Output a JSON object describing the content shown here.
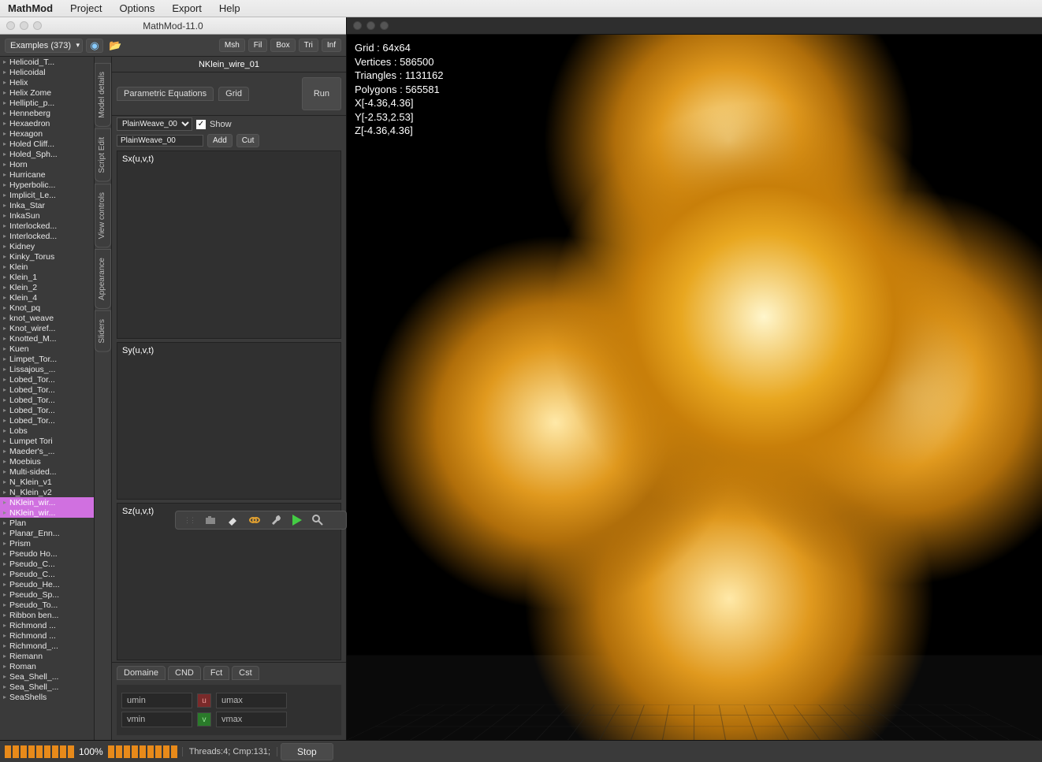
{
  "menu": {
    "app": "MathMod",
    "items": [
      "Project",
      "Options",
      "Export",
      "Help"
    ]
  },
  "leftWin": {
    "title": "MathMod-11.0"
  },
  "toolbar": {
    "dropdown": "Examples (373)",
    "buttons": [
      "Msh",
      "Fil",
      "Box",
      "Tri",
      "Inf"
    ]
  },
  "examples": [
    "Helicoid_T...",
    "Helicoidal",
    "Helix",
    "Helix Zome",
    "Helliptic_p...",
    "Henneberg",
    "Hexaedron",
    "Hexagon",
    "Holed Cliff...",
    "Holed_Sph...",
    "Horn",
    "Hurricane",
    "Hyperbolic...",
    "Implicit_Le...",
    "Inka_Star",
    "InkaSun",
    "Interlocked...",
    "Interlocked...",
    "Kidney",
    "Kinky_Torus",
    "Klein",
    "Klein_1",
    "Klein_2",
    "Klein_4",
    "Knot_pq",
    "knot_weave",
    "Knot_wiref...",
    "Knotted_M...",
    "Kuen",
    "Limpet_Tor...",
    "Lissajous_...",
    "Lobed_Tor...",
    "Lobed_Tor...",
    "Lobed_Tor...",
    "Lobed_Tor...",
    "Lobed_Tor...",
    "Lobs",
    "Lumpet Tori",
    "Maeder's_...",
    "Moebius",
    "Multi-sided...",
    "N_Klein_v1",
    "N_Klein_v2",
    "NKlein_wir...",
    "NKlein_wir...",
    "Plan",
    "Planar_Enn...",
    "Prism",
    "Pseudo Ho...",
    "Pseudo_C...",
    "Pseudo_C...",
    "Pseudo_He...",
    "Pseudo_Sp...",
    "Pseudo_To...",
    "Ribbon ben...",
    "Richmond ...",
    "Richmond ...",
    "Richmond_...",
    "Riemann",
    "Roman",
    "Sea_Shell_...",
    "Sea_Shell_...",
    "SeaShells"
  ],
  "selectedExample": "NKlein_wir...",
  "sideTabs": [
    "Model details",
    "Script Edit",
    "View controls",
    "Appearance",
    "Sliders"
  ],
  "model": {
    "title": "NKlein_wire_01",
    "tabA": "Parametric Equations",
    "tabB": "Grid",
    "select": "PlainWeave_00",
    "showChecked": true,
    "showLabel": "Show",
    "input": "PlainWeave_00",
    "addBtn": "Add",
    "cutBtn": "Cut",
    "runBtn": "Run",
    "sx": "Sx(u,v,t)",
    "sy": "Sy(u,v,t)",
    "sz": "Sz(u,v,t)"
  },
  "botTabs": [
    "Domaine",
    "CND",
    "Fct",
    "Cst"
  ],
  "domain": {
    "umin": "umin",
    "umax": "umax",
    "vmin": "vmin",
    "vmax": "vmax",
    "u": "u",
    "v": "v"
  },
  "stats": {
    "grid": "Grid     : 64x64",
    "vertices": "Vertices : 586500",
    "triangles": "Triangles : 1131162",
    "polygons": "Polygons : 565581",
    "x": "X[-4.36,4.36]",
    "y": "Y[-2.53,2.53]",
    "z": "Z[-4.36,4.36]"
  },
  "status": {
    "pct": "100%",
    "threads": "Threads:4; Cmp:131;",
    "stop": "Stop"
  }
}
